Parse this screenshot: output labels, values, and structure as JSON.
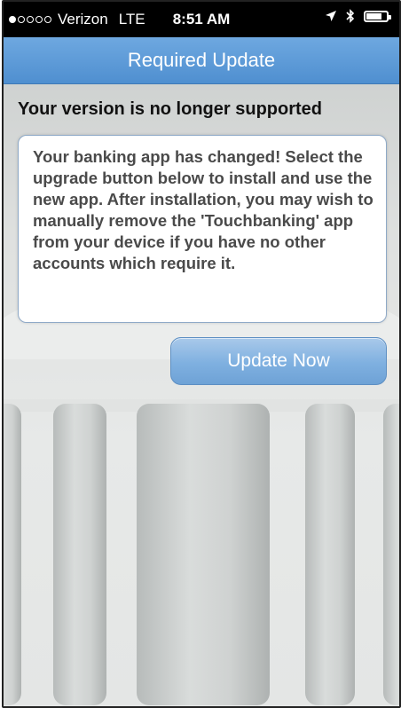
{
  "status_bar": {
    "carrier": "Verizon",
    "network": "LTE",
    "time": "8:51 AM",
    "signal_filled": 1,
    "signal_total": 5,
    "battery_level": 0.75
  },
  "nav": {
    "title": "Required Update"
  },
  "main": {
    "headline": "Your version is no longer supported",
    "message": "Your banking app has changed! Select the upgrade button below to install and use the new app. After installation, you may wish to manually remove the 'Touchbanking' app from your device if you have no other accounts which require it.",
    "button_label": "Update Now"
  },
  "colors": {
    "nav_bar": "#5a98d6",
    "button": "#7fb0e0"
  }
}
